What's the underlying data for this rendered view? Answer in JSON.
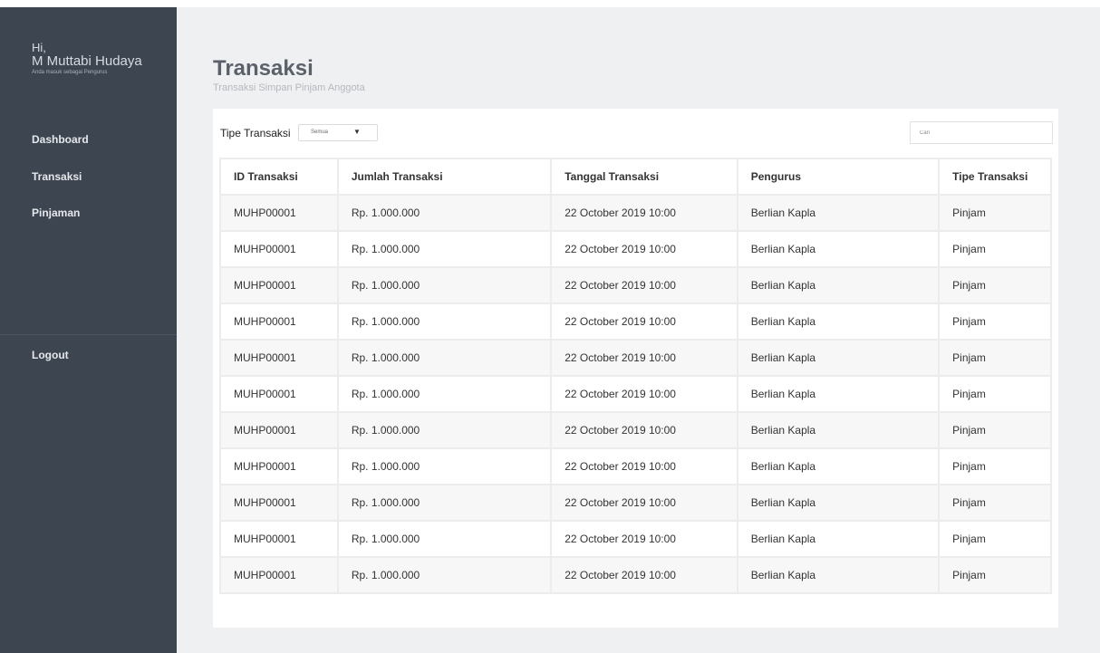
{
  "sidebar": {
    "greeting": "Hi,",
    "user_name": "M Muttabi Hudaya",
    "role_text": "Anda masuk sebagai Pengurus",
    "items": [
      {
        "label": "Dashboard"
      },
      {
        "label": "Transaksi"
      },
      {
        "label": "Pinjaman"
      }
    ],
    "logout_label": "Logout"
  },
  "header": {
    "title": "Transaksi",
    "subtitle": "Transaksi Simpan Pinjam Anggota"
  },
  "filter": {
    "label": "Tipe Transaksi",
    "selected": "Semua",
    "caret": "▼"
  },
  "search": {
    "placeholder": "Cari"
  },
  "table": {
    "columns": [
      "ID Transaksi",
      "Jumlah Transaksi",
      "Tanggal Transaksi",
      "Pengurus",
      "Tipe Transaksi"
    ],
    "rows": [
      [
        "MUHP00001",
        "Rp. 1.000.000",
        "22 October 2019 10:00",
        "Berlian Kapla",
        "Pinjam"
      ],
      [
        "MUHP00001",
        "Rp. 1.000.000",
        "22 October 2019 10:00",
        "Berlian Kapla",
        "Pinjam"
      ],
      [
        "MUHP00001",
        "Rp. 1.000.000",
        "22 October 2019 10:00",
        "Berlian Kapla",
        "Pinjam"
      ],
      [
        "MUHP00001",
        "Rp. 1.000.000",
        "22 October 2019 10:00",
        "Berlian Kapla",
        "Pinjam"
      ],
      [
        "MUHP00001",
        "Rp. 1.000.000",
        "22 October 2019 10:00",
        "Berlian Kapla",
        "Pinjam"
      ],
      [
        "MUHP00001",
        "Rp. 1.000.000",
        "22 October 2019 10:00",
        "Berlian Kapla",
        "Pinjam"
      ],
      [
        "MUHP00001",
        "Rp. 1.000.000",
        "22 October 2019 10:00",
        "Berlian Kapla",
        "Pinjam"
      ],
      [
        "MUHP00001",
        "Rp. 1.000.000",
        "22 October 2019 10:00",
        "Berlian Kapla",
        "Pinjam"
      ],
      [
        "MUHP00001",
        "Rp. 1.000.000",
        "22 October 2019 10:00",
        "Berlian Kapla",
        "Pinjam"
      ],
      [
        "MUHP00001",
        "Rp. 1.000.000",
        "22 October 2019 10:00",
        "Berlian Kapla",
        "Pinjam"
      ],
      [
        "MUHP00001",
        "Rp. 1.000.000",
        "22 October 2019 10:00",
        "Berlian Kapla",
        "Pinjam"
      ]
    ]
  },
  "colors": {
    "sidebar_bg": "#3d4551",
    "page_bg": "#eff0f2",
    "title": "#5b616b"
  }
}
